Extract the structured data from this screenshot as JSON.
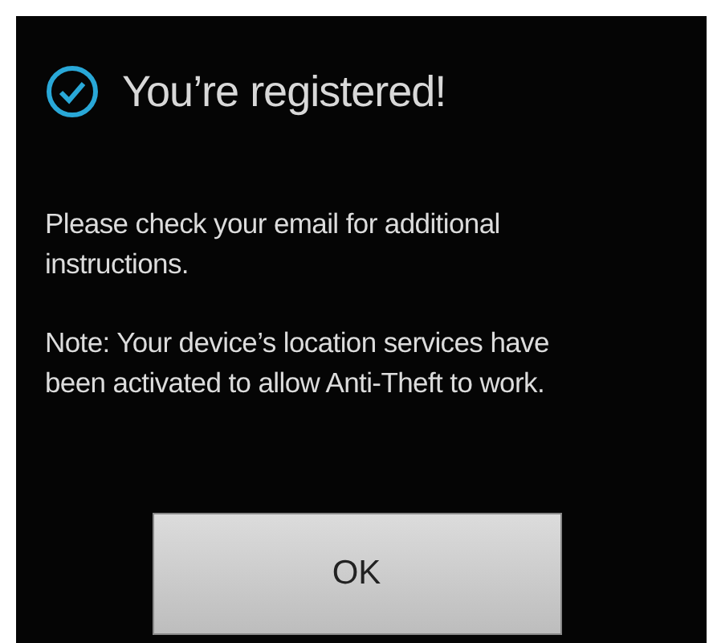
{
  "dialog": {
    "title": "You’re registered!",
    "paragraphs": [
      "Please check your email for additional instructions.",
      "Note: Your device’s location services have been activated to allow Anti-Theft to work."
    ],
    "buttons": [
      "OK"
    ]
  }
}
